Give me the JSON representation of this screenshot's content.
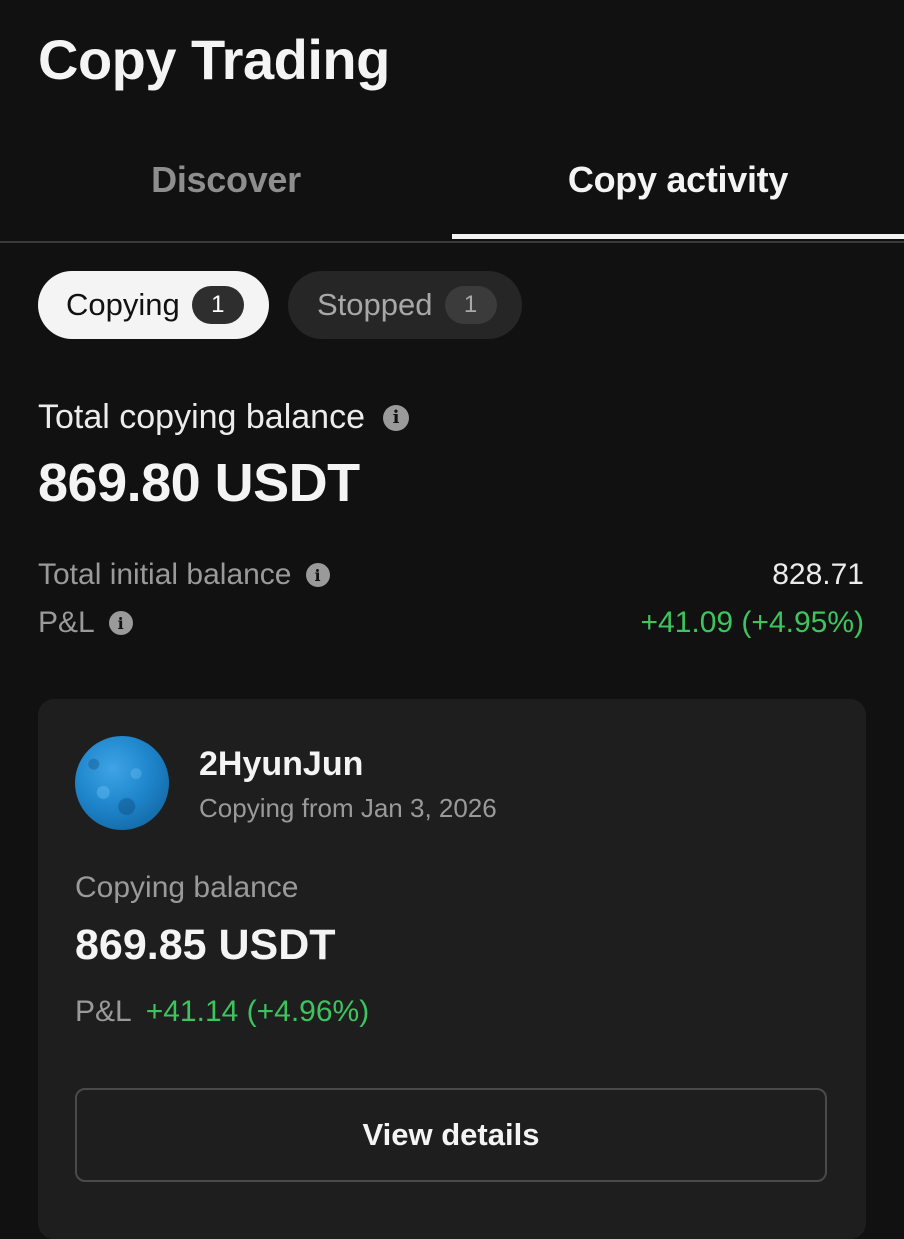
{
  "header": {
    "title": "Copy Trading"
  },
  "tabs": [
    {
      "label": "Discover",
      "active": false
    },
    {
      "label": "Copy activity",
      "active": true
    }
  ],
  "filters": {
    "copying": {
      "label": "Copying",
      "count": "1",
      "selected": true
    },
    "stopped": {
      "label": "Stopped",
      "count": "1",
      "selected": false
    }
  },
  "summary": {
    "total_label": "Total copying balance",
    "total_value": "869.80 USDT",
    "initial_label": "Total initial balance",
    "initial_value": "828.71",
    "pnl_label": "P&L",
    "pnl_value": "+41.09 (+4.95%)"
  },
  "trader_card": {
    "name": "2HyunJun",
    "copying_from": "Copying from Jan 3, 2026",
    "balance_label": "Copying balance",
    "balance_value": "869.85 USDT",
    "pnl_label": "P&L",
    "pnl_value": "+41.14 (+4.96%)",
    "button_label": "View details"
  },
  "icons": {
    "info": "info-icon",
    "avatar": "avatar"
  },
  "colors": {
    "background": "#111111",
    "card": "#1e1e1e",
    "positive": "#3dc45f",
    "muted_text": "#9a9a9a",
    "primary_text": "#f4f4f4"
  }
}
